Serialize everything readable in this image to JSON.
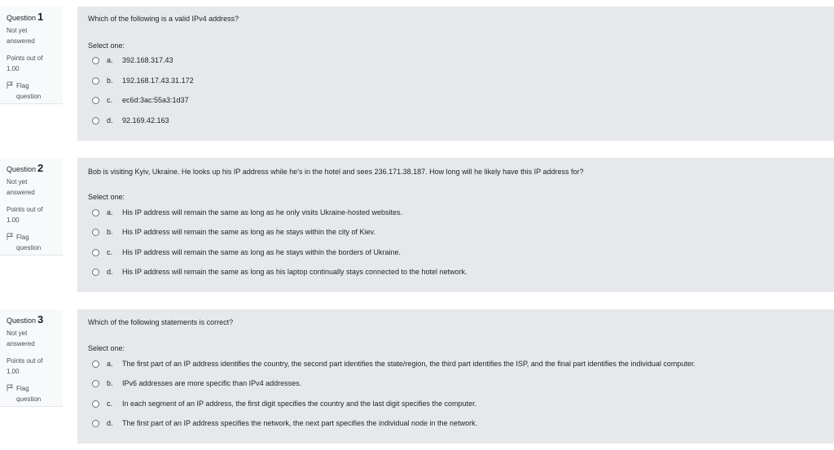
{
  "questions": [
    {
      "label": "Question",
      "number": "1",
      "state": "Not yet answered",
      "grade": "Points out of 1.00",
      "flag": "Flag question",
      "text": "Which of the following is a valid IPv4 address?",
      "prompt": "Select one:",
      "answers": [
        {
          "letter": "a.",
          "text": "392.168.317.43"
        },
        {
          "letter": "b.",
          "text": "192.168.17.43.31.172"
        },
        {
          "letter": "c.",
          "text": "ec6d:3ac:55a3:1d37"
        },
        {
          "letter": "d.",
          "text": "92.169.42.163"
        }
      ]
    },
    {
      "label": "Question",
      "number": "2",
      "state": "Not yet answered",
      "grade": "Points out of 1.00",
      "flag": "Flag question",
      "text": "Bob is visiting Kyiv, Ukraine. He looks up his IP address while he's in the hotel and sees 236.171.38.187. How long will he likely have this IP address for?",
      "prompt": "Select one:",
      "answers": [
        {
          "letter": "a.",
          "text": "His IP address will remain the same as long as he only visits Ukraine-hosted websites."
        },
        {
          "letter": "b.",
          "text": "His IP address will remain the same as long as he stays within the city of Kiev."
        },
        {
          "letter": "c.",
          "text": "His IP address will remain the same as long as he stays within the borders of Ukraine."
        },
        {
          "letter": "d.",
          "text": "His IP address will remain the same as long as his laptop continually stays connected to the hotel network."
        }
      ]
    },
    {
      "label": "Question",
      "number": "3",
      "state": "Not yet answered",
      "grade": "Points out of 1.00",
      "flag": "Flag question",
      "text": "Which of the following statements is correct?",
      "prompt": "Select one:",
      "answers": [
        {
          "letter": "a.",
          "text": "The first part of an IP address identifies the country, the second part identifies the state/region, the third part identifies the ISP, and the final part identifies the individual computer."
        },
        {
          "letter": "b.",
          "text": "IPv6 addresses are more specific than IPv4 addresses."
        },
        {
          "letter": "c.",
          "text": "In each segment of an IP address, the first digit specifies the country and the last digit specifies the computer."
        },
        {
          "letter": "d.",
          "text": "The first part of an IP address specifies the network, the next part specifies the individual node in the network."
        }
      ]
    }
  ]
}
